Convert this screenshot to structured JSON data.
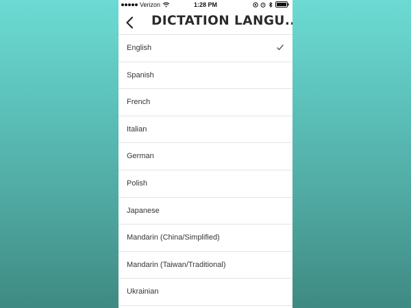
{
  "status_bar": {
    "carrier": "Verizon",
    "time": "1:28 PM"
  },
  "nav": {
    "title": "DICTATION LANGU..."
  },
  "languages": [
    {
      "label": "English",
      "selected": true
    },
    {
      "label": "Spanish",
      "selected": false
    },
    {
      "label": "French",
      "selected": false
    },
    {
      "label": "Italian",
      "selected": false
    },
    {
      "label": "German",
      "selected": false
    },
    {
      "label": "Polish",
      "selected": false
    },
    {
      "label": "Japanese",
      "selected": false
    },
    {
      "label": "Mandarin (China/Simplified)",
      "selected": false
    },
    {
      "label": "Mandarin (Taiwan/Traditional)",
      "selected": false
    },
    {
      "label": "Ukrainian",
      "selected": false
    }
  ],
  "colors": {
    "background_top": "#6cdbd3",
    "background_bottom": "#3f8a82",
    "text": "#333333",
    "divider": "#e3e3e3"
  }
}
